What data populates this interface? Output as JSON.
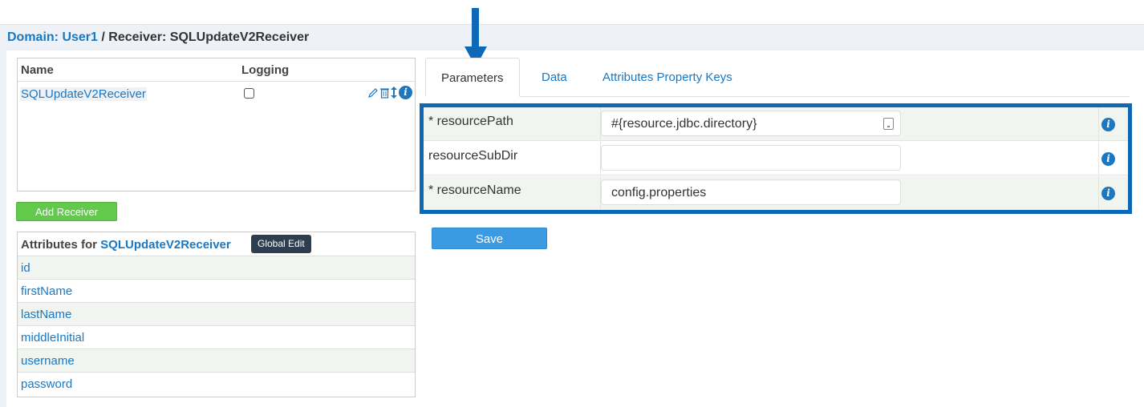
{
  "breadcrumb": {
    "domain_label": "Domain:",
    "domain_value": "User1",
    "separator": " / ",
    "receiver_label": "Receiver:",
    "receiver_value": "SQLUpdateV2Receiver"
  },
  "receivers_table": {
    "col_name": "Name",
    "col_logging": "Logging",
    "rows": [
      {
        "name": "SQLUpdateV2Receiver",
        "logging_checked": false
      }
    ]
  },
  "add_receiver_label": "Add Receiver",
  "attributes": {
    "title_prefix": "Attributes for",
    "receiver_name": "SQLUpdateV2Receiver",
    "global_edit_label": "Global Edit",
    "items": [
      "id",
      "firstName",
      "lastName",
      "middleInitial",
      "username",
      "password"
    ]
  },
  "tabs": [
    {
      "label": "Parameters",
      "active": true
    },
    {
      "label": "Data",
      "active": false
    },
    {
      "label": "Attributes Property Keys",
      "active": false
    }
  ],
  "parameters": [
    {
      "label": "* resourcePath",
      "value": "#{resource.jdbc.directory}",
      "has_picker": true
    },
    {
      "label": "resourceSubDir",
      "value": "",
      "has_picker": false
    },
    {
      "label": "* resourceName",
      "value": "config.properties",
      "has_picker": false
    }
  ],
  "save_label": "Save",
  "icons": {
    "info": "info-icon",
    "edit": "pencil-icon",
    "delete": "trash-icon",
    "move": "up-down-arrow-icon",
    "picker": "property-picker-icon",
    "annotation": "down-arrow-icon"
  },
  "colors": {
    "link": "#1a78c2",
    "highlight_border": "#0d68b5",
    "add_button": "#62c94a",
    "save_button": "#3b9ae1",
    "global_edit": "#2c3e50"
  }
}
